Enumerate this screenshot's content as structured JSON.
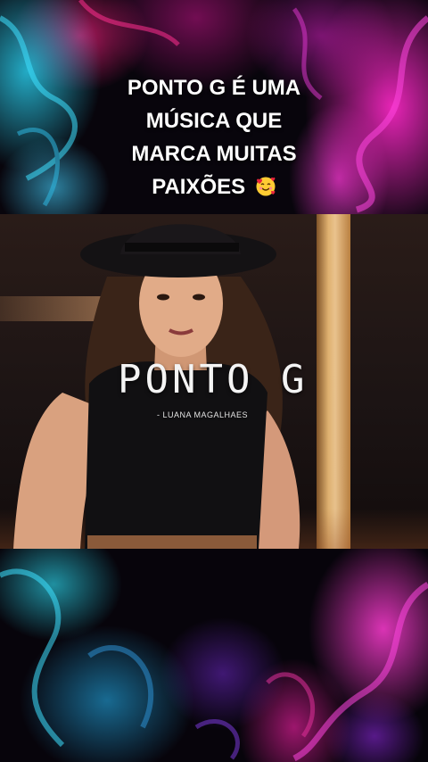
{
  "caption": {
    "line1": "PONTO G É UMA",
    "line2": "MÚSICA QUE",
    "line3": "MARCA MUITAS",
    "line4": "PAIXÕES",
    "emoji": "smiling-face-with-hearts-icon"
  },
  "video": {
    "title": "PONTO G",
    "subtitle": "- LUANA MAGALHAES"
  },
  "colors": {
    "smoke_cyan": "#28c8e6",
    "smoke_magenta": "#ff28c8",
    "caption_text": "#ffffff",
    "emoji_face": "#ffcc33",
    "emoji_heart": "#e8243c"
  }
}
